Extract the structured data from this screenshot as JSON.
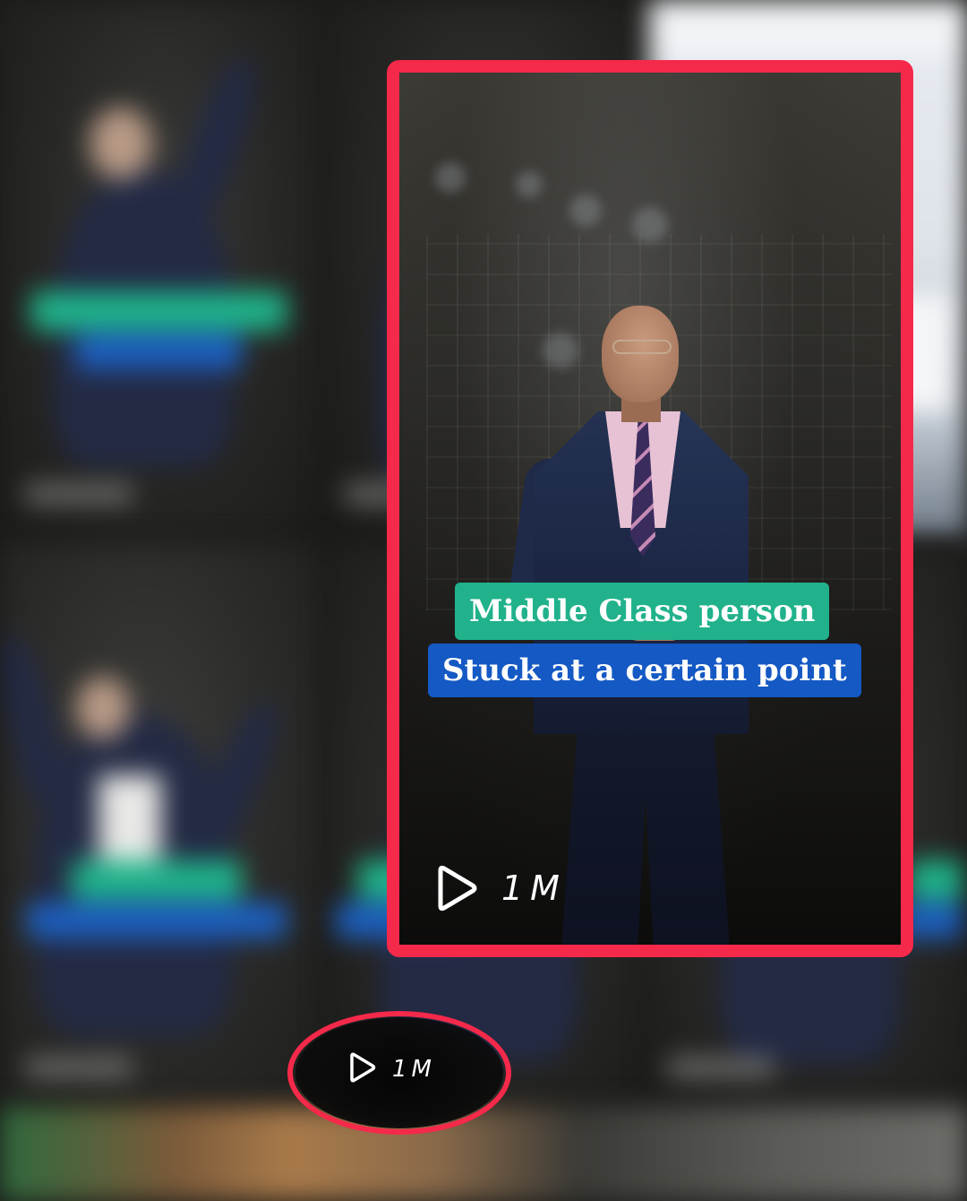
{
  "highlighted_video": {
    "caption_line1": "Middle Class person",
    "caption_line2": "Stuck at a certain point",
    "view_count": "1M",
    "play_icon": "play-icon"
  },
  "callout": {
    "view_count": "1M",
    "play_icon": "play-icon"
  },
  "colors": {
    "highlight_border": "#f5294a",
    "caption_green": "#21b28b",
    "caption_blue": "#1459c4"
  }
}
